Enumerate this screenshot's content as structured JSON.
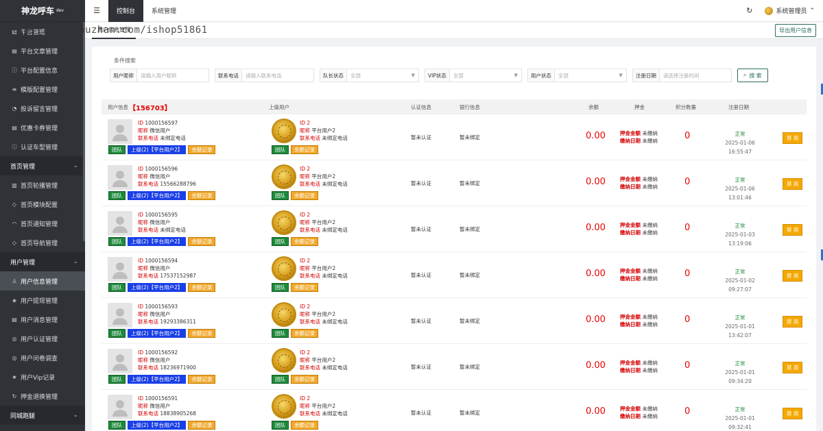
{
  "brand": {
    "name": "神龙呼车",
    "tag": "dev"
  },
  "watermark": "https://www.huzhan.com/ishop51861",
  "sidebar": {
    "top_items": [
      {
        "label": "平台管理",
        "icon": "▤"
      },
      {
        "label": "平台文章管理",
        "icon": "▤"
      },
      {
        "label": "平台配置信息",
        "icon": "ⓘ"
      },
      {
        "label": "模版配置管理",
        "icon": "≡"
      },
      {
        "label": "投诉留言管理",
        "icon": "◔"
      },
      {
        "label": "优惠卡券管理",
        "icon": "▤"
      },
      {
        "label": "认证车型管理",
        "icon": "ⓘ"
      }
    ],
    "group_home": "首页管理",
    "home_items": [
      {
        "label": "首页轮播管理",
        "icon": "▥"
      },
      {
        "label": "首页模块配置",
        "icon": "◇"
      },
      {
        "label": "首页通知管理",
        "icon": "◠"
      },
      {
        "label": "首页导航管理",
        "icon": "◇"
      }
    ],
    "group_user": "用户管理",
    "user_items": [
      {
        "label": "用户信息管理",
        "icon": "♙"
      },
      {
        "label": "用户提现管理",
        "icon": "◈"
      },
      {
        "label": "用户消息管理",
        "icon": "▤"
      },
      {
        "label": "用户认证管理",
        "icon": "◎"
      },
      {
        "label": "用户问卷调查",
        "icon": "◎"
      },
      {
        "label": "用户Vip记录",
        "icon": "★"
      },
      {
        "label": "押金退换管理",
        "icon": "↻"
      }
    ],
    "group_city": "同城跑腿"
  },
  "topbar": {
    "tab1": "控制台",
    "tab2": "系统管理",
    "user": "系统管理员"
  },
  "tabbar": {
    "page_tab": "用户信息管理",
    "export": "导出用户信息"
  },
  "search": {
    "title": "条件搜索",
    "fields": {
      "nick_label": "用户昵称",
      "nick_ph": "请输入用户昵称",
      "phone_label": "联系电话",
      "phone_ph": "请输入联系电话",
      "leader_label": "队长状态",
      "leader_val": "全部",
      "vip_label": "VIP状态",
      "vip_val": "全部",
      "user_label": "用户状态",
      "user_val": "全部",
      "reg_label": "注册日期",
      "reg_ph": "请选择注册时间"
    },
    "button": "搜 索"
  },
  "table": {
    "headers": {
      "user": "用户信息",
      "count": "【156703】",
      "parent": "上级用户",
      "auth": "认证信息",
      "bank": "银行信息",
      "balance": "余额",
      "deposit": "押金",
      "points": "积分数量",
      "reg": "注册日期"
    },
    "labels": {
      "id": "ID",
      "nick": "昵称",
      "phone": "联系电话",
      "deposit_amt": "押金金额",
      "deposit_date": "缴纳日期"
    },
    "badges": {
      "team": "团队",
      "parent": "上级(2)【平台用户2】",
      "balance_log": "余额记录",
      "ban": "禁 用"
    },
    "rows": [
      {
        "id": "1000156597",
        "nick": "微信用户",
        "phone": "未绑定电话",
        "pid": "2",
        "pnick": "平台用户2",
        "pphone": "未绑定电话",
        "auth": "暂未认证",
        "bank": "暂未绑定",
        "balance": "0.00",
        "dep_amt": "未缴纳",
        "dep_date": "未缴纳",
        "points": "0",
        "status": "正常",
        "date": "2025-01-06 16:55:47"
      },
      {
        "id": "1000156596",
        "nick": "微信用户",
        "phone": "15566288796",
        "pid": "2",
        "pnick": "平台用户2",
        "pphone": "未绑定电话",
        "auth": "暂未认证",
        "bank": "暂未绑定",
        "balance": "0.00",
        "dep_amt": "未缴纳",
        "dep_date": "未缴纳",
        "points": "0",
        "status": "正常",
        "date": "2025-01-06 13:01:46"
      },
      {
        "id": "1000156595",
        "nick": "微信用户",
        "phone": "未绑定电话",
        "pid": "2",
        "pnick": "平台用户2",
        "pphone": "未绑定电话",
        "auth": "暂未认证",
        "bank": "暂未绑定",
        "balance": "0.00",
        "dep_amt": "未缴纳",
        "dep_date": "未缴纳",
        "points": "0",
        "status": "正常",
        "date": "2025-01-03 13:19:06"
      },
      {
        "id": "1000156594",
        "nick": "微信用户",
        "phone": "17537152987",
        "pid": "2",
        "pnick": "平台用户2",
        "pphone": "未绑定电话",
        "auth": "暂未认证",
        "bank": "暂未绑定",
        "balance": "0.00",
        "dep_amt": "未缴纳",
        "dep_date": "未缴纳",
        "points": "0",
        "status": "正常",
        "date": "2025-01-02 09:27:07"
      },
      {
        "id": "1000156593",
        "nick": "微信用户",
        "phone": "19293386311",
        "pid": "2",
        "pnick": "平台用户2",
        "pphone": "未绑定电话",
        "auth": "暂未认证",
        "bank": "暂未绑定",
        "balance": "0.00",
        "dep_amt": "未缴纳",
        "dep_date": "未缴纳",
        "points": "0",
        "status": "正常",
        "date": "2025-01-01 13:42:07"
      },
      {
        "id": "1000156592",
        "nick": "微信用户",
        "phone": "18236971900",
        "pid": "2",
        "pnick": "平台用户2",
        "pphone": "未绑定电话",
        "auth": "暂未认证",
        "bank": "暂未绑定",
        "balance": "0.00",
        "dep_amt": "未缴纳",
        "dep_date": "未缴纳",
        "points": "0",
        "status": "正常",
        "date": "2025-01-01 09:34:20"
      },
      {
        "id": "1000156591",
        "nick": "微信用户",
        "phone": "18838905268",
        "pid": "2",
        "pnick": "平台用户2",
        "pphone": "未绑定电话",
        "auth": "暂未认证",
        "bank": "暂未绑定",
        "balance": "0.00",
        "dep_amt": "未缴纳",
        "dep_date": "未缴纳",
        "points": "0",
        "status": "正常",
        "date": "2025-01-01 09:32:41"
      }
    ]
  },
  "colors": {
    "sidebar_bg": "#2f3338",
    "accent": "#2a6e5f",
    "red": "#e60000",
    "green": "#1e8a3b",
    "blue": "#1a3fe6",
    "orange": "#f0a92e"
  }
}
